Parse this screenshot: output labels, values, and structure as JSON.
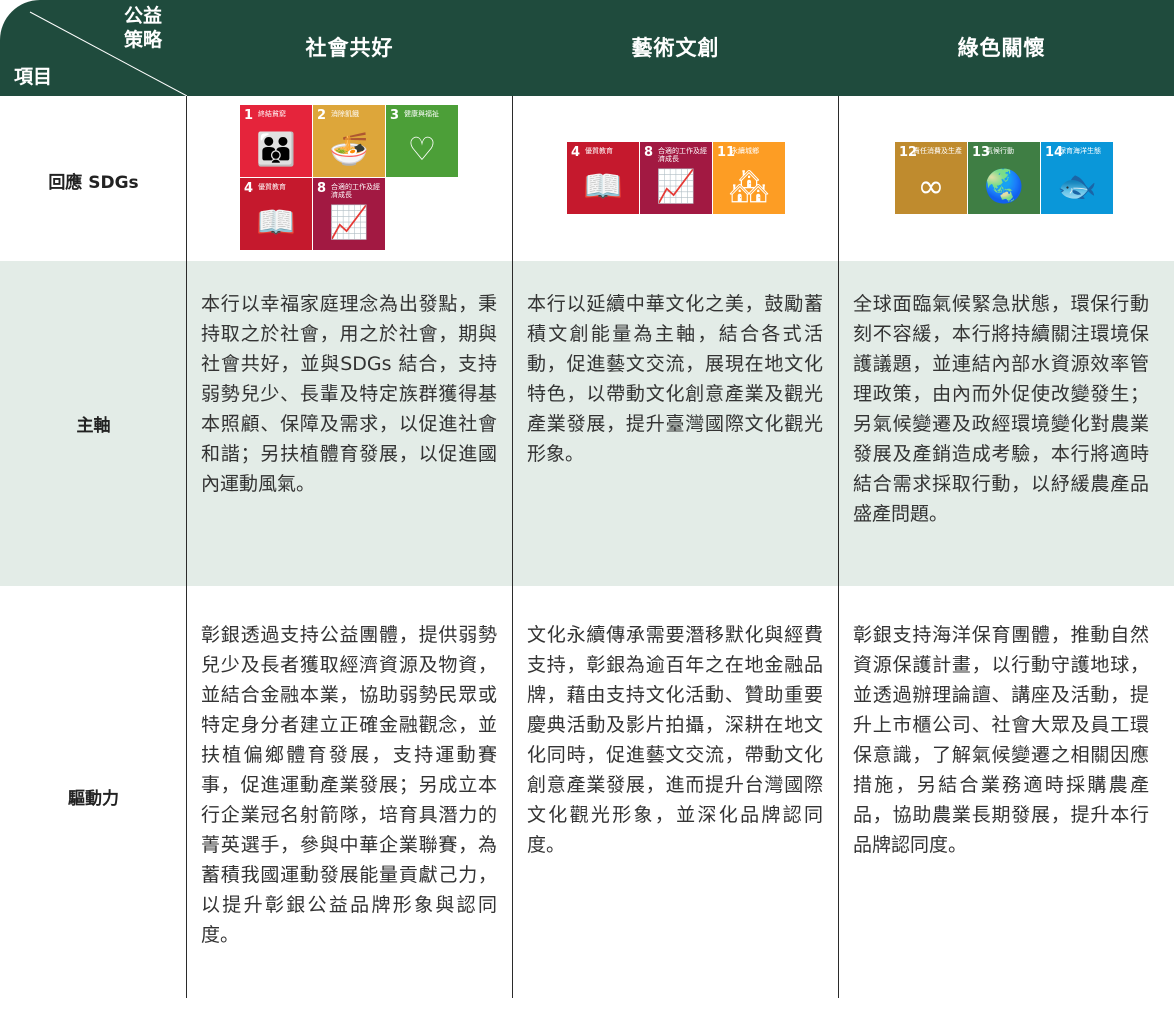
{
  "header": {
    "corner_top": "公益策略",
    "corner_bottom": "項目",
    "columns": [
      "社會共好",
      "藝術文創",
      "綠色關懷"
    ]
  },
  "rows": {
    "sdg_label": "回應 SDGs",
    "main_label": "主軸",
    "drive_label": "驅動力"
  },
  "sdg_tiles": {
    "social": [
      {
        "num": "1",
        "title": "終結貧窮",
        "color": "#e5243b",
        "icon": "family-icon"
      },
      {
        "num": "2",
        "title": "消除飢餓",
        "color": "#dda63a",
        "icon": "bowl-icon"
      },
      {
        "num": "3",
        "title": "健康與福祉",
        "color": "#4c9f38",
        "icon": "heartbeat-icon"
      },
      {
        "num": "4",
        "title": "優質教育",
        "color": "#c5192d",
        "icon": "book-icon"
      },
      {
        "num": "8",
        "title": "合適的工作及經濟成長",
        "color": "#a21942",
        "icon": "growth-chart-icon"
      }
    ],
    "arts": [
      {
        "num": "4",
        "title": "優質教育",
        "color": "#c5192d",
        "icon": "book-icon"
      },
      {
        "num": "8",
        "title": "合適的工作及經濟成長",
        "color": "#a21942",
        "icon": "growth-chart-icon"
      },
      {
        "num": "11",
        "title": "永續城鄉",
        "color": "#fd9d24",
        "icon": "city-icon"
      }
    ],
    "green": [
      {
        "num": "12",
        "title": "責任消費及生產",
        "color": "#bf8b2e",
        "icon": "infinity-icon"
      },
      {
        "num": "13",
        "title": "氣候行動",
        "color": "#3f7e44",
        "icon": "eye-globe-icon"
      },
      {
        "num": "14",
        "title": "保育海洋生態",
        "color": "#0a97d9",
        "icon": "fish-icon"
      }
    ]
  },
  "main": {
    "social": "本行以幸福家庭理念為出發點，秉持取之於社會，用之於社會，期與社會共好，並與SDGs 結合，支持弱勢兒少、長輩及特定族群獲得基本照顧、保障及需求，以促進社會和諧；另扶植體育發展，以促進國內運動風氣。",
    "arts": "本行以延續中華文化之美，鼓勵蓄積文創能量為主軸，結合各式活動，促進藝文交流，展現在地文化特色，以帶動文化創意產業及觀光產業發展，提升臺灣國際文化觀光形象。",
    "green": "全球面臨氣候緊急狀態，環保行動刻不容緩，本行將持續關注環境保護議題，並連結內部水資源效率管理政策，由內而外促使改變發生；另氣候變遷及政經環境變化對農業發展及產銷造成考驗，本行將適時結合需求採取行動，以紓緩農產品盛產問題。"
  },
  "drive": {
    "social": "彰銀透過支持公益團體，提供弱勢兒少及長者獲取經濟資源及物資，並結合金融本業，協助弱勢民眾或特定身分者建立正確金融觀念，並扶植偏鄉體育發展，支持運動賽事，促進運動產業發展；另成立本行企業冠名射箭隊，培育具潛力的菁英選手，參與中華企業聯賽，為蓄積我國運動發展能量貢獻己力，以提升彰銀公益品牌形象與認同度。",
    "arts": "文化永續傳承需要潛移默化與經費支持，彰銀為逾百年之在地金融品牌，藉由支持文化活動、贊助重要慶典活動及影片拍攝，深耕在地文化同時，促進藝文交流，帶動文化創意產業發展，進而提升台灣國際文化觀光形象，並深化品牌認同度。",
    "green": "彰銀支持海洋保育團體，推動自然資源保護計畫，以行動守護地球，並透過辦理論譠、講座及活動，提升上市櫃公司、社會大眾及員工環保意識，了解氣候變遷之相關因應措施，另結合業務適時採購農產品，協助農業長期發展，提升本行品牌認同度。"
  }
}
